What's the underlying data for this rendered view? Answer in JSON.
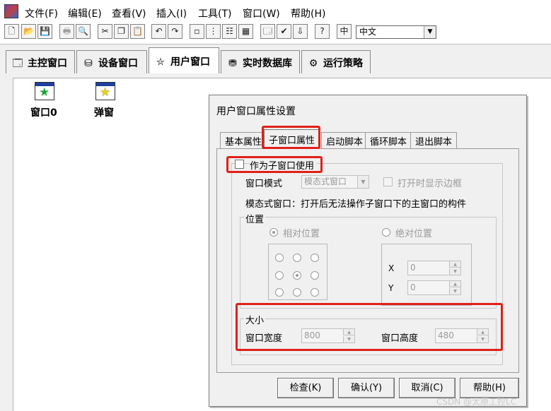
{
  "menu": [
    "文件(F)",
    "编辑(E)",
    "查看(V)",
    "插入(I)",
    "工具(T)",
    "窗口(W)",
    "帮助(H)"
  ],
  "toolbar": {
    "buttons": [
      {
        "name": "new-icon",
        "glyph": "🗋"
      },
      {
        "name": "open-icon",
        "glyph": "📂"
      },
      {
        "name": "save-icon",
        "glyph": "💾"
      },
      {
        "name": "print-icon",
        "glyph": "🖶"
      },
      {
        "name": "print-preview-icon",
        "glyph": "🔍"
      },
      {
        "name": "cut-icon",
        "glyph": "✂"
      },
      {
        "name": "copy-icon",
        "glyph": "❐"
      },
      {
        "name": "paste-icon",
        "glyph": "📋"
      },
      {
        "name": "undo-icon",
        "glyph": "↶"
      },
      {
        "name": "redo-icon",
        "glyph": "↷"
      },
      {
        "name": "small-icons-icon",
        "glyph": "▫"
      },
      {
        "name": "tree-view-icon",
        "glyph": "⋮"
      },
      {
        "name": "list-view-icon",
        "glyph": "☷"
      },
      {
        "name": "detail-view-icon",
        "glyph": "▦"
      },
      {
        "name": "properties-icon",
        "glyph": "🗔"
      },
      {
        "name": "check-icon",
        "glyph": "✔"
      },
      {
        "name": "compile-icon",
        "glyph": "⇩"
      },
      {
        "name": "help-icon",
        "glyph": "?"
      },
      {
        "name": "language-icon",
        "glyph": "中"
      }
    ],
    "language": "中文"
  },
  "workspace_tabs": [
    {
      "label": "主控窗口",
      "icon": "🗔"
    },
    {
      "label": "设备窗口",
      "icon": "⛁"
    },
    {
      "label": "用户窗口",
      "icon": "⛦"
    },
    {
      "label": "实时数据库",
      "icon": "⛃"
    },
    {
      "label": "运行策略",
      "icon": "⚙"
    }
  ],
  "user_windows": [
    {
      "label": "窗口0",
      "star_color": "#1ca63a"
    },
    {
      "label": "弹窗",
      "star_color": "#e8d21a"
    }
  ],
  "dialog": {
    "title": "用户窗口属性设置",
    "tabs": [
      "基本属性",
      "子窗口属性",
      "启动脚本",
      "循环脚本",
      "退出脚本"
    ],
    "subwindow_check_label": "作为子窗口使用",
    "window_mode_label": "窗口模式",
    "window_mode_value": "模态式窗口",
    "show_border_label": "打开时显示边框",
    "modal_desc": "模态式窗口：打开后无法操作子窗口下的主窗口的构件",
    "position_group": "位置",
    "relative_pos": "相对位置",
    "absolute_pos": "绝对位置",
    "x_label": "X",
    "y_label": "Y",
    "x_value": "0",
    "y_value": "0",
    "size_group": "大小",
    "width_label": "窗口宽度",
    "width_value": "800",
    "height_label": "窗口高度",
    "height_value": "480",
    "buttons": {
      "check": "检查(K)",
      "ok": "确认(Y)",
      "cancel": "取消(C)",
      "help": "帮助(H)"
    }
  },
  "watermark": "CSDN @太原工控LC",
  "colors": {
    "highlight_red": "#e0201a",
    "title_bar_blue": "#1f3f9f"
  }
}
